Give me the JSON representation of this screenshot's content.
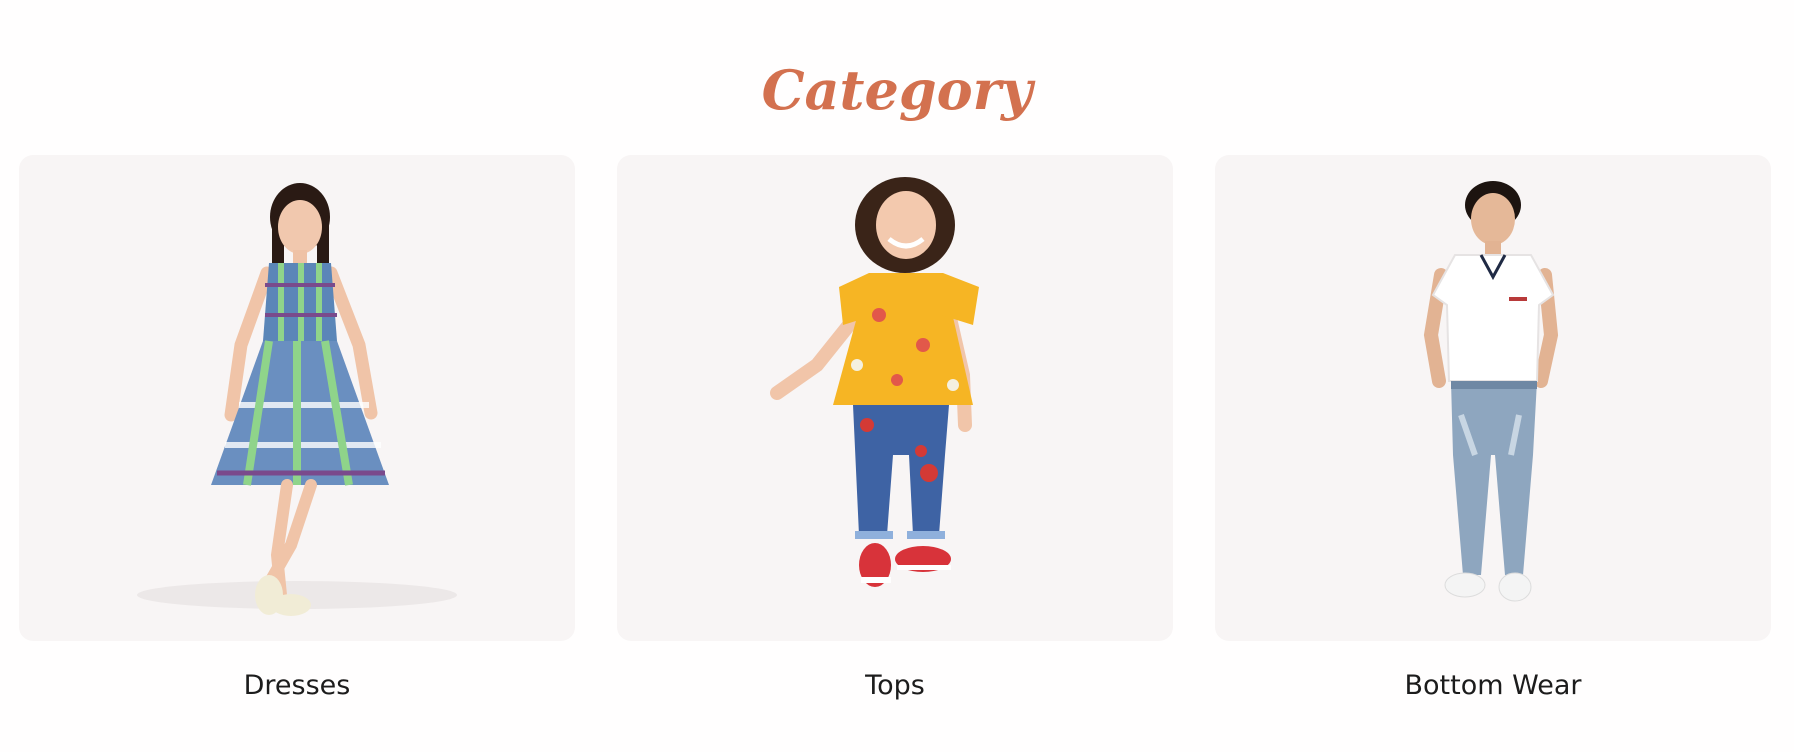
{
  "section": {
    "title": "Category"
  },
  "categories": [
    {
      "label": "Dresses",
      "image": "girl-in-plaid-dress"
    },
    {
      "label": "Tops",
      "image": "girl-in-yellow-floral-top"
    },
    {
      "label": "Bottom Wear",
      "image": "boy-in-white-polo-and-jeans"
    }
  ],
  "colors": {
    "title": "#d3714f",
    "card_background": "#f8f5f5",
    "label_text": "#1c1c1c"
  }
}
